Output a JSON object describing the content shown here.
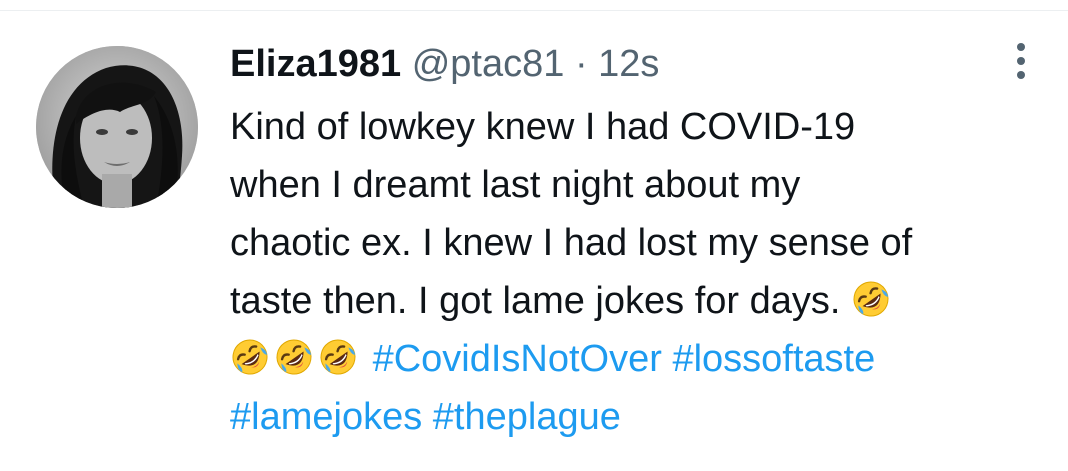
{
  "tweet": {
    "display_name": "Eliza1981",
    "handle": "@ptac81",
    "separator": "·",
    "timestamp": "12s",
    "text_lines": [
      "Kind of lowkey knew I had COVID-19",
      "when I dreamt last night about my",
      "chaotic ex. I knew I had lost my sense of",
      "taste then. I got lame jokes for days."
    ],
    "emoji_name": "rolling-on-the-floor-laughing",
    "hashtags": [
      "#CovidIsNotOver",
      "#lossoftaste",
      "#lamejokes",
      "#theplague"
    ]
  },
  "colors": {
    "text": "#0f1419",
    "secondary": "#536471",
    "link": "#1d9bf0",
    "divider": "#eceff1"
  },
  "icons": {
    "more": "more-vertical-icon",
    "avatar": "avatar-photo"
  }
}
